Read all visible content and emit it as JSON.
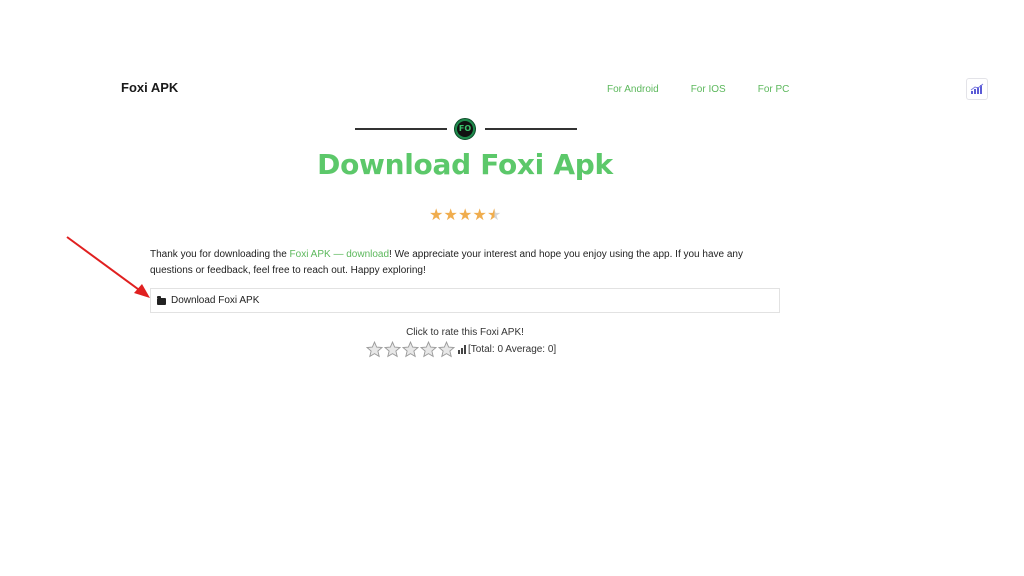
{
  "header": {
    "brand": "Foxi APK",
    "nav": [
      "For Android",
      "For IOS",
      "For PC"
    ],
    "corner_icon": "chart-icon"
  },
  "hero": {
    "logo_text": "FO",
    "title": "Download Foxi Apk",
    "rating_stars": 4.5
  },
  "content": {
    "desc_before": "Thank you for downloading the ",
    "desc_link": "Foxi APK — download",
    "desc_after": "! We appreciate your interest and hope you enjoy using the app. If you have any questions or feedback, feel free to reach out. Happy exploring!",
    "download_label": "Download Foxi APK"
  },
  "rating": {
    "prompt": "Click to rate this Foxi APK!",
    "stats": "[Total: 0 Average: 0]"
  },
  "colors": {
    "accent": "#5cb85c",
    "title": "#5cc86a",
    "star": "#f0ad4e",
    "arrow": "#e02020"
  }
}
